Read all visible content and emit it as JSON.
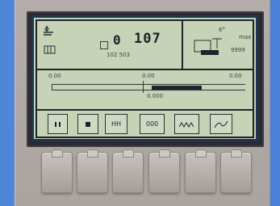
{
  "display": {
    "counter_left": "0",
    "counter_right": "107",
    "counter_sub": "102 503",
    "top_right_value": "6°",
    "top_right_unit": "max",
    "top_right_sub": "9999",
    "scale_left": "0.00",
    "scale_mid": "0.00",
    "scale_right": "0.00",
    "scale_value": "0.000"
  },
  "softkeys": [
    {
      "label": "",
      "icon": "pause-icon"
    },
    {
      "label": "",
      "icon": "stop-icon"
    },
    {
      "label": "HH",
      "icon": "bars-icon"
    },
    {
      "label": "000",
      "icon": "digits-icon"
    },
    {
      "label": "",
      "icon": "wave-icon"
    },
    {
      "label": "",
      "icon": "curve-icon"
    }
  ]
}
